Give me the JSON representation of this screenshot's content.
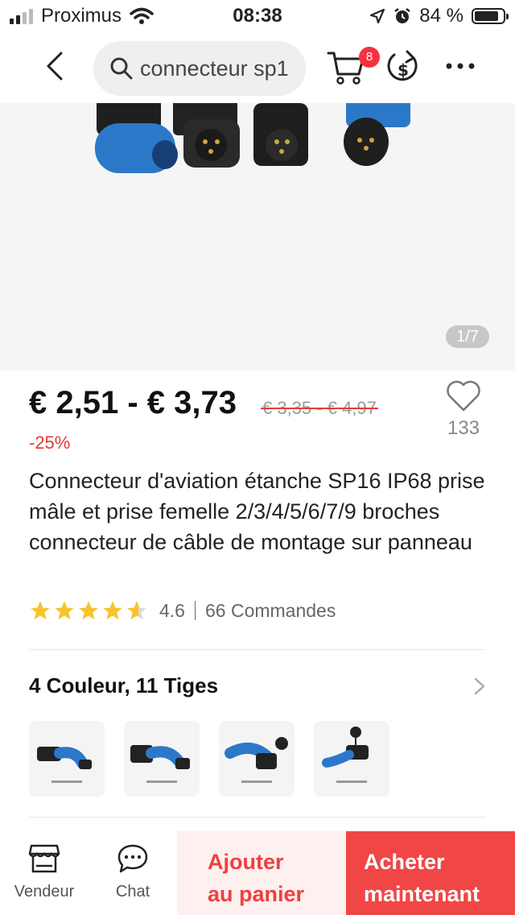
{
  "status_bar": {
    "carrier": "Proximus",
    "time": "08:38",
    "battery": "84 %"
  },
  "search": {
    "query": "connecteur sp1"
  },
  "cart": {
    "count": "8"
  },
  "gallery": {
    "pager": "1/7"
  },
  "product": {
    "price_range": "€ 2,51 - € 3,73",
    "original_price_range": "€ 3,35 - € 4,97",
    "discount": "-25%",
    "wishlist_count": "133",
    "title": "Connecteur d'aviation étanche SP16 IP68 prise mâle et prise femelle 2/3/4/5/6/7/9 broches connecteur de câble de montage sur panneau",
    "rating": "4.6",
    "orders": "66 Commandes",
    "variants_label": "4 Couleur, 11 Tiges"
  },
  "bottom_bar": {
    "vendor": "Vendeur",
    "chat": "Chat",
    "add_to_cart_line1": "Ajouter",
    "add_to_cart_line2": "au panier",
    "buy_now_line1": "Acheter",
    "buy_now_line2": "maintenant"
  },
  "colors": {
    "accent": "#f04646",
    "star": "#f7c32e",
    "badge": "#f5333f"
  },
  "icons": [
    "back-icon",
    "search-icon",
    "cart-icon",
    "coin-icon",
    "more-icon",
    "heart-icon",
    "star-icon",
    "chevron-right-icon",
    "store-icon",
    "chat-icon"
  ]
}
